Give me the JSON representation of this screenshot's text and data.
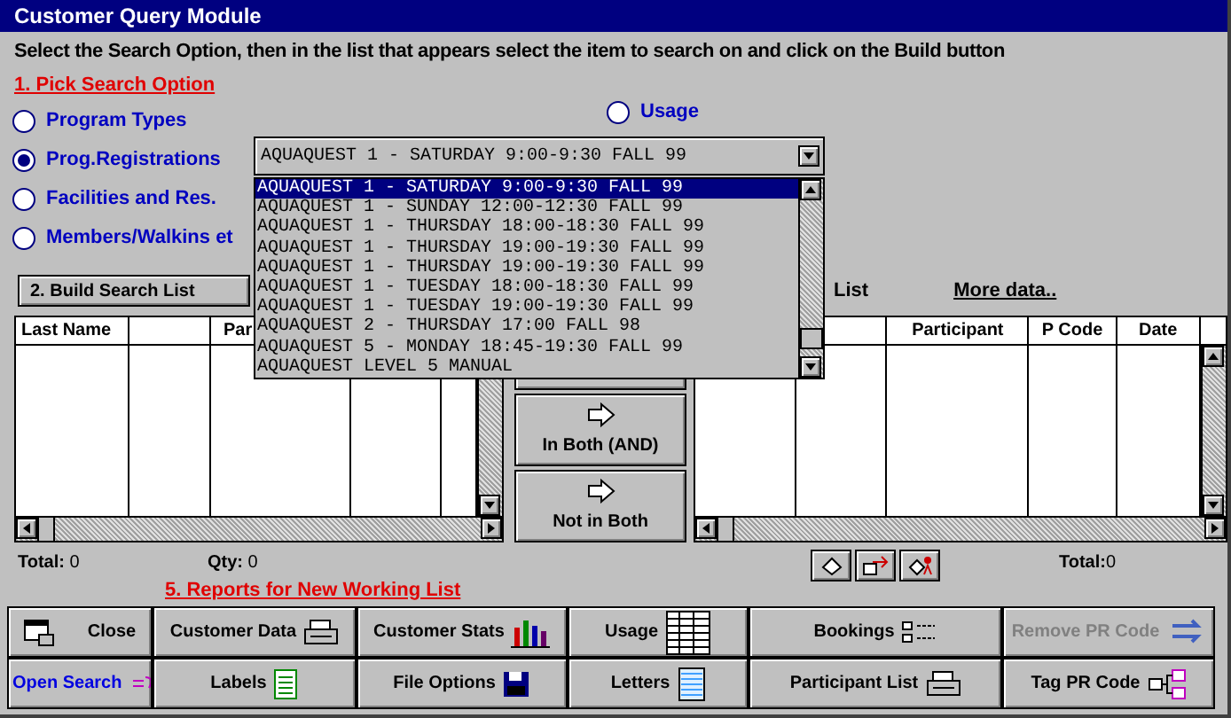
{
  "window": {
    "title": "Customer Query Module"
  },
  "instruction": "Select the Search Option, then in the list that appears select the item to search on and click on the Build button",
  "step1_heading": "1. Pick Search Option",
  "search_options": [
    {
      "label": "Program Types",
      "selected": false
    },
    {
      "label": "Prog.Registrations",
      "selected": true
    },
    {
      "label": "Facilities and Res.",
      "selected": false
    },
    {
      "label": "Members/Walkins et",
      "selected": false
    }
  ],
  "usage_option": {
    "label": "Usage",
    "selected": false
  },
  "combo": {
    "value": "AQUAQUEST 1 - SATURDAY 9:00-9:30 FALL 99"
  },
  "list_items": [
    {
      "label": "AQUAQUEST 1 - SATURDAY 9:00-9:30 FALL 99",
      "selected": true
    },
    {
      "label": "AQUAQUEST 1 - SUNDAY 12:00-12:30 FALL 99",
      "selected": false
    },
    {
      "label": "AQUAQUEST 1 - THURSDAY 18:00-18:30 FALL 99",
      "selected": false
    },
    {
      "label": "AQUAQUEST 1 - THURSDAY 19:00-19:30 FALL 99",
      "selected": false
    },
    {
      "label": "AQUAQUEST 1 - THURSDAY 19:00-19:30 FALL 99",
      "selected": false
    },
    {
      "label": "AQUAQUEST 1 - TUESDAY 18:00-18:30 FALL 99",
      "selected": false
    },
    {
      "label": "AQUAQUEST 1 - TUESDAY 19:00-19:30 FALL 99",
      "selected": false
    },
    {
      "label": "AQUAQUEST 2 - THURSDAY 17:00 FALL 98",
      "selected": false
    },
    {
      "label": "AQUAQUEST 5 - MONDAY 18:45-19:30 FALL 99",
      "selected": false
    },
    {
      "label": "AQUAQUEST LEVEL 5 MANUAL",
      "selected": false
    }
  ],
  "build_button": "2. Build Search List",
  "right_labels": [
    "List",
    "More data.."
  ],
  "left_table": {
    "columns": [
      {
        "heading": "Last Name"
      },
      {},
      {
        "heading": "Par"
      },
      {},
      {}
    ]
  },
  "merge_buttons": [
    "In Both (AND)",
    "Not in Both"
  ],
  "right_table": {
    "columns": [
      {},
      {},
      {
        "heading": "Participant"
      },
      {
        "heading": "P Code"
      },
      {
        "heading": "Date"
      }
    ]
  },
  "left_totals": {
    "total_label": "Total:",
    "total": "0",
    "qty_label": "Qty:",
    "qty": "0"
  },
  "right_total": {
    "label": "Total:",
    "value": "0"
  },
  "step5_heading": "5. Reports for New Working List",
  "buttons": [
    {
      "label": "Close",
      "kind": "normal",
      "disabled": false
    },
    {
      "label": "Customer Data",
      "kind": "normal",
      "disabled": false
    },
    {
      "label": "Customer Stats",
      "kind": "normal",
      "disabled": false
    },
    {
      "label": "Usage",
      "kind": "normal",
      "disabled": false
    },
    {
      "label": "Bookings",
      "kind": "normal",
      "disabled": false
    },
    {
      "label": "Remove PR Code",
      "kind": "normal",
      "disabled": true
    },
    {
      "label": "Open Search",
      "kind": "accent",
      "disabled": false
    },
    {
      "label": "Labels",
      "kind": "normal",
      "disabled": false
    },
    {
      "label": "File Options",
      "kind": "normal",
      "disabled": false
    },
    {
      "label": "Letters",
      "kind": "normal",
      "disabled": false
    },
    {
      "label": "Participant List",
      "kind": "normal",
      "disabled": false
    },
    {
      "label": "Tag PR Code",
      "kind": "normal",
      "disabled": false
    }
  ]
}
